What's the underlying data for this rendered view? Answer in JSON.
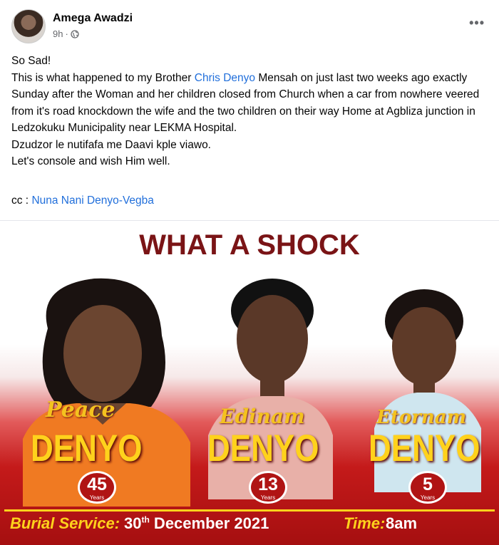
{
  "post": {
    "author": "Amega Awadzi",
    "time": "9h",
    "audience_icon": "globe-icon",
    "more_icon": "more-options-icon",
    "lines": [
      "So Sad!",
      "This is what happened to my Brother ",
      "Chris Denyo",
      " Mensah on just last two weeks ago exactly Sunday after the Woman and her children closed from Church when a car from nowhere veered from it's road  knockdown the wife and the two children on their way Home at Agbliza junction in Ledzokuku Municipality near LEKMA Hospital.",
      "Dzudzor le nutifafa me Daavi kple viawo.",
      "Let's console and wish Him well."
    ],
    "cc_label": "cc :",
    "cc_link": "Nuna Nani Denyo-Vegba"
  },
  "poster": {
    "title": "WHAT A SHOCK",
    "people": [
      {
        "first": "Peace",
        "last": "DENYO",
        "age": "45",
        "age_unit": "Years"
      },
      {
        "first": "Edinam",
        "last": "DENYO",
        "age": "13",
        "age_unit": "Years"
      },
      {
        "first": "Etornam",
        "last": "DENYO",
        "age": "5",
        "age_unit": "Years"
      }
    ],
    "burial_label": "Burial Service:",
    "burial_day": "30",
    "burial_suffix": "th",
    "burial_rest": " December 2021",
    "time_label": "Time:",
    "time_value": "8am"
  },
  "colors": {
    "link": "#216fdb",
    "poster_red": "#c41a1a",
    "poster_yellow": "#ffd21c",
    "title_red": "#7a1416"
  }
}
